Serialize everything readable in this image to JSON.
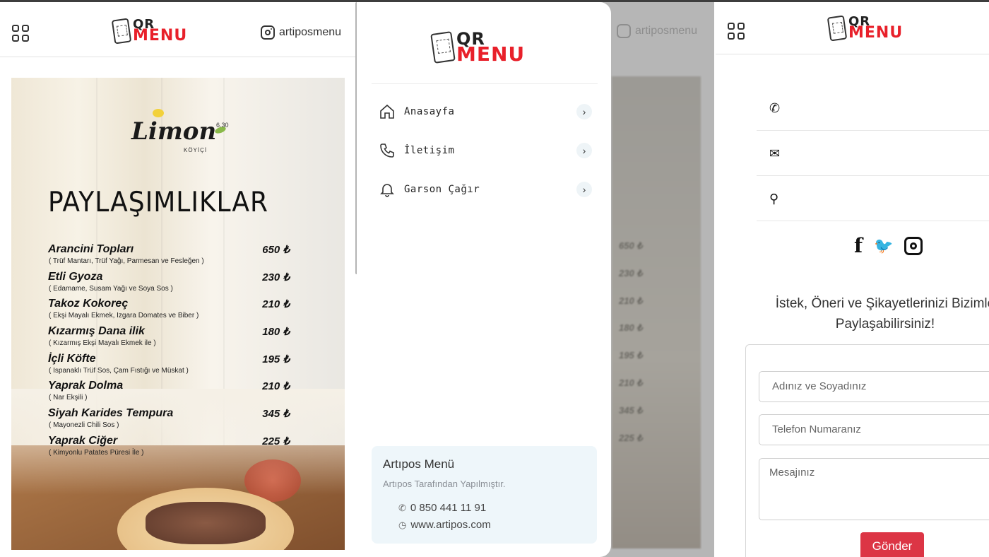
{
  "brand": {
    "logo_top": "QR",
    "logo_bottom": "MENU",
    "primary_color": "#e8202a"
  },
  "panel1": {
    "instagram_handle": "artiposmenu",
    "menu_card": {
      "restaurant_logo": "Limon",
      "restaurant_sub": "KÖYİÇİ",
      "restaurant_top": "6.30",
      "category_title": "PAYLAŞIMLIKLAR",
      "items": [
        {
          "name": "Arancini Topları",
          "desc": "( Trüf Mantarı, Trüf Yağı, Parmesan ve Fesleğen )",
          "price": "650 ₺"
        },
        {
          "name": "Etli Gyoza",
          "desc": "( Edamame, Susam Yağı ve Soya Sos )",
          "price": "230 ₺"
        },
        {
          "name": "Takoz Kokoreç",
          "desc": "( Ekşi Mayalı Ekmek, Izgara Domates ve Biber )",
          "price": "210 ₺"
        },
        {
          "name": "Kızarmış Dana ilik",
          "desc": "( Kızarmış Ekşi Mayalı Ekmek ile )",
          "price": "180 ₺"
        },
        {
          "name": "İçli Köfte",
          "desc": "( Ispanaklı Trüf Sos, Çam Fıstığı ve Müskat )",
          "price": "195 ₺"
        },
        {
          "name": "Yaprak Dolma",
          "desc": "( Nar Ekşili )",
          "price": "210 ₺"
        },
        {
          "name": "Siyah Karides Tempura",
          "desc": "( Mayonezli Chili Sos )",
          "price": "345 ₺"
        },
        {
          "name": "Yaprak Ciğer",
          "desc": "( Kimyonlu Patates Püresi İle )",
          "price": "225 ₺"
        }
      ]
    }
  },
  "panel2": {
    "background_instagram": "artiposmenu",
    "background_prices": [
      "650 ₺",
      "230 ₺",
      "210 ₺",
      "180 ₺",
      "195 ₺",
      "210 ₺",
      "345 ₺",
      "225 ₺"
    ],
    "nav": [
      {
        "label": "Anasayfa",
        "icon": "home-icon"
      },
      {
        "label": "İletişim",
        "icon": "phone-icon"
      },
      {
        "label": "Garson Çağır",
        "icon": "bell-icon"
      }
    ],
    "info": {
      "title": "Artıpos Menü",
      "subtitle": "Artıpos Tarafından Yapılmıştır.",
      "phone": "0 850 441 11 91",
      "website": "www.artipos.com"
    }
  },
  "panel3": {
    "headline": "İstek, Öneri ve Şikayetlerinizi Bizimle Paylaşabilirsiniz!",
    "form": {
      "name_placeholder": "Adınız ve Soyadınız",
      "phone_placeholder": "Telefon Numaranız",
      "message_placeholder": "Mesajınız",
      "submit_label": "Gönder",
      "submit_color": "#dc3545"
    }
  }
}
